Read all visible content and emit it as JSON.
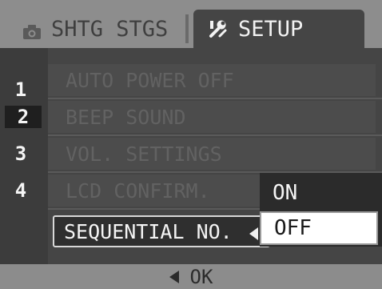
{
  "tabs": [
    {
      "label": "SHTG STGS",
      "icon": "camera-icon",
      "active": false
    },
    {
      "label": "SETUP",
      "icon": "tools-icon",
      "active": true
    }
  ],
  "pages": [
    "1",
    "2",
    "3",
    "4"
  ],
  "active_page": "2",
  "menu": {
    "items": [
      {
        "label": "AUTO POWER OFF"
      },
      {
        "label": "BEEP SOUND"
      },
      {
        "label": "VOL. SETTINGS"
      },
      {
        "label": "LCD CONFIRM."
      },
      {
        "label": "SEQUENTIAL NO."
      }
    ],
    "selected": "SEQUENTIAL NO."
  },
  "options": {
    "items": [
      "ON",
      "OFF"
    ],
    "selected": "OFF"
  },
  "bottom": {
    "label": "OK",
    "icon": "left-arrow-icon"
  },
  "colors": {
    "tab_bar": "#8d8d8d",
    "background": "#454545",
    "highlight": "#ffffff"
  }
}
